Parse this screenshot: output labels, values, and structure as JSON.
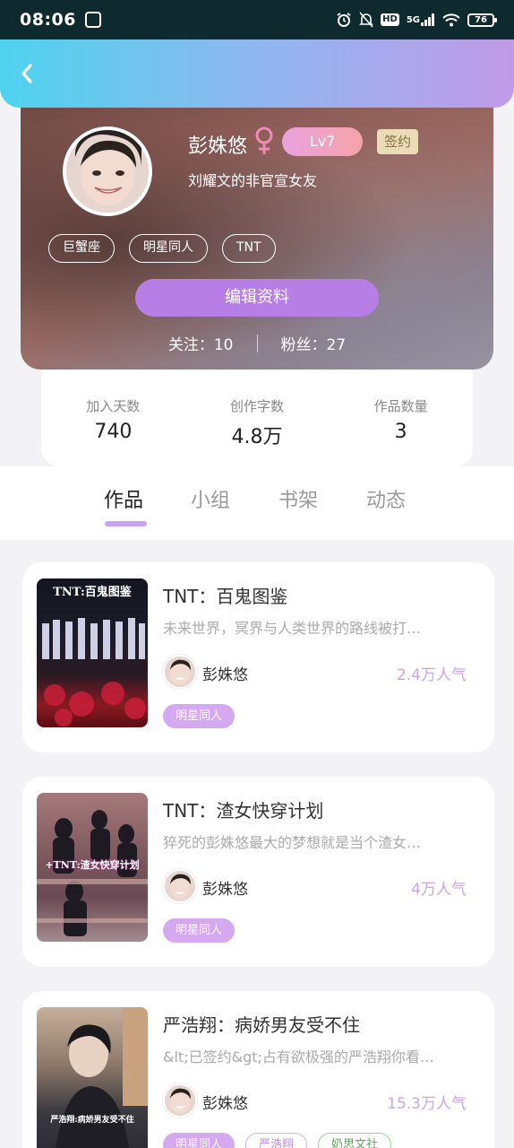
{
  "status_bar": {
    "time": "08:06",
    "hd": "HD",
    "network": "5G",
    "battery": "76"
  },
  "profile": {
    "name": "彭姝悠",
    "level": "Lv7",
    "sign_badge": "签约",
    "bio": "刘耀文的非官宣女友",
    "tags": [
      "巨蟹座",
      "明星同人",
      "TNT"
    ],
    "edit_label": "编辑资料",
    "following_label": "关注：",
    "following_count": "10",
    "fans_label": "粉丝：",
    "fans_count": "27"
  },
  "stats": [
    {
      "label": "加入天数",
      "value": "740"
    },
    {
      "label": "创作字数",
      "value": "4.8万"
    },
    {
      "label": "作品数量",
      "value": "3"
    }
  ],
  "tabs": [
    "作品",
    "小组",
    "书架",
    "动态"
  ],
  "active_tab": "作品",
  "works": [
    {
      "title": "TNT：百鬼图鉴",
      "desc": "未来世界，冥界与人类世界的路线被打…",
      "author": "彭姝悠",
      "popularity": "2.4万人气",
      "cover_text": "TNT:百鬼图鉴",
      "tags": [
        "明星同人"
      ]
    },
    {
      "title": "TNT：渣女快穿计划",
      "desc": "猝死的彭姝悠最大的梦想就是当个渣女…",
      "author": "彭姝悠",
      "popularity": "4万人气",
      "cover_text": "+TNT:渣女快穿计划",
      "tags": [
        "明星同人"
      ]
    },
    {
      "title": "严浩翔：病娇男友受不住",
      "desc": "&lt;已签约&gt;占有欲极强的严浩翔你看…",
      "author": "彭姝悠",
      "popularity": "15.3万人气",
      "cover_text": "严浩翔:病娇男友受不住",
      "tags": [
        "明星同人",
        "严浩翔",
        "奶思文社"
      ]
    }
  ],
  "colors": {
    "accent": "#c8a5ea",
    "header_start": "#4ed3ee",
    "header_end": "#c19ae8",
    "edit_button": "#b77fe6"
  }
}
